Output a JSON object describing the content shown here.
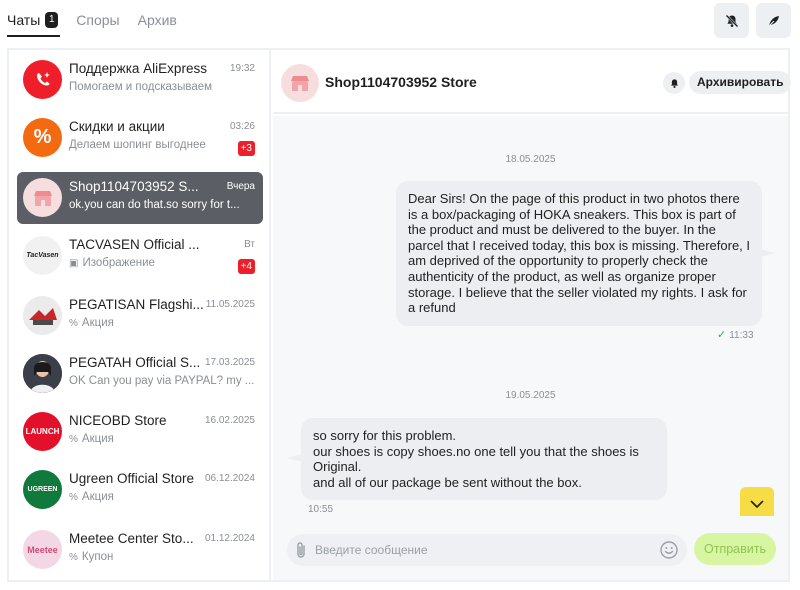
{
  "tabs": [
    {
      "label": "Чаты",
      "badge": "1"
    },
    {
      "label": "Споры"
    },
    {
      "label": "Архив"
    }
  ],
  "chats": [
    {
      "name": "Поддержка AliExpress",
      "time": "19:32",
      "subtitle": "Помогаем и подсказываем",
      "avatar_color": "#ee1f2a"
    },
    {
      "name": "Скидки и акции",
      "time": "03:26",
      "subtitle": "Делаем шопинг выгоднее",
      "badge": "+3",
      "avatar_color": "#f36a10"
    },
    {
      "name": "Shop1104703952 S...",
      "time": "Вчера",
      "subtitle": "ok.you can do that.so sorry for t...",
      "selected": true
    },
    {
      "name": "TACVASEN Official ...",
      "time": "Вт",
      "subtitle": "Изображение",
      "badge": "+4",
      "avatar_text": "TacVasen"
    },
    {
      "name": "PEGATISAN Flagshi...",
      "time": "11.05.2025",
      "subtitle": "Акция"
    },
    {
      "name": "PEGATAH Official S...",
      "time": "17.03.2025",
      "subtitle": "OK Can you pay via PAYPAL? my ..."
    },
    {
      "name": "NICEOBD Store",
      "time": "16.02.2025",
      "subtitle": "Акция",
      "avatar_text": "LAUNCH"
    },
    {
      "name": "Ugreen Official Store",
      "time": "06.12.2024",
      "subtitle": "Акция",
      "avatar_text": "UGREEN"
    },
    {
      "name": "Meetee Center Sto...",
      "time": "01.12.2024",
      "subtitle": "Купон",
      "avatar_text": "Meetee"
    }
  ],
  "conversation": {
    "title": "Shop1104703952 Store",
    "archive_label": "Архивировать",
    "date1": "18.05.2025",
    "message_out": "Dear Sirs! On the page of this product in two photos there is a box/packaging of HOKA sneakers. This box is part of the product and must be delivered to the buyer. In the parcel that I received today, this box is missing. Therefore, I am deprived of the opportunity to properly check the authenticity of the product, as well as organize proper storage. I believe that the seller violated my rights. I ask for a refund",
    "message_out_time": "11:33",
    "date2": "19.05.2025",
    "message_in_lines": [
      "so sorry for this problem.",
      "our shoes is copy shoes.no one tell you that the shoes is Original.",
      "and all of our package be sent without the box."
    ],
    "message_in_time": "10:55"
  },
  "composer": {
    "placeholder": "Введите сообщение",
    "send_label": "Отправить"
  },
  "colors": {
    "accent_red": "#ee1f2a",
    "send_bg": "#d8f5a2",
    "scroll_btn": "#f6dc45",
    "selected_item": "#5b5e64"
  }
}
